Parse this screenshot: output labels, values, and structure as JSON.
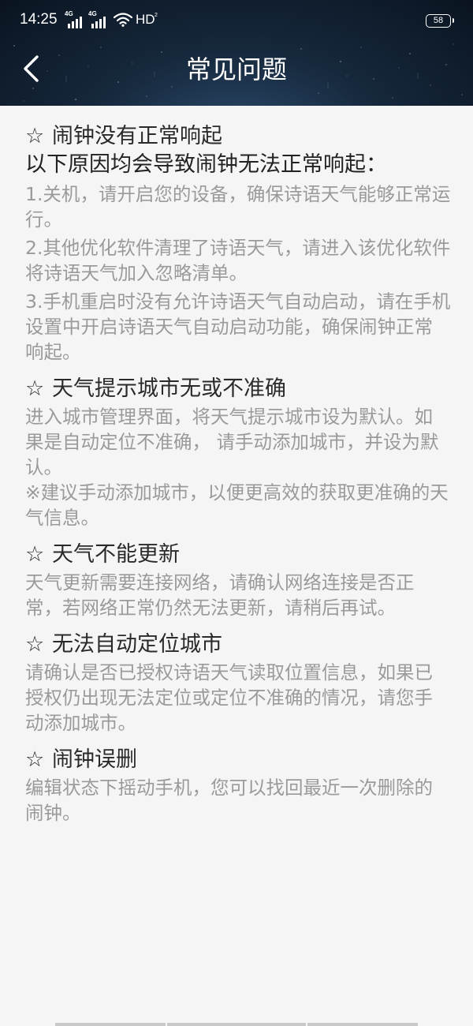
{
  "status_bar": {
    "time": "14:25",
    "signal_1_label": "4G",
    "signal_2_label": "4G",
    "hd_label": "HD",
    "hd_sub_label": "2",
    "battery": "58"
  },
  "header": {
    "title": "常见问题",
    "back_icon": "chevron-left-icon"
  },
  "faq": [
    {
      "question": "闹钟没有正常响起",
      "subtitle": "以下原因均会导致闹钟无法正常响起：",
      "answers": [
        "1.关机，请开启您的设备，确保诗语天气能够正常运行。",
        "2.其他优化软件清理了诗语天气，请进入该优化软件将诗语天气加入忽略清单。",
        "3.手机重启时没有允许诗语天气自动启动，请在手机设置中开启诗语天气自动启动功能，确保闹钟正常响起。"
      ]
    },
    {
      "question": "天气提示城市无或不准确",
      "answers": [
        "进入城市管理界面，将天气提示城市设为默认。如果是自动定位不准确， 请手动添加城市，并设为默认。",
        "※建议手动添加城市，以便更高效的获取更准确的天气信息。"
      ]
    },
    {
      "question": "天气不能更新",
      "answers": [
        "天气更新需要连接网络，请确认网络连接是否正常，若网络正常仍然无法更新，请稍后再试。"
      ]
    },
    {
      "question": "无法自动定位城市",
      "answers": [
        "请确认是否已授权诗语天气读取位置信息，如果已授权仍出现无法定位或定位不准确的情况，请您手动添加城市。"
      ]
    },
    {
      "question": "闹钟误删",
      "answers": [
        "编辑状态下摇动手机，您可以找回最近一次删除的闹钟。"
      ]
    }
  ],
  "star_glyph": "☆",
  "colors": {
    "header_bg": "#16283c",
    "page_bg": "#f5f5f5",
    "question_text": "#2a2a2a",
    "answer_text": "#9a9a9a"
  }
}
